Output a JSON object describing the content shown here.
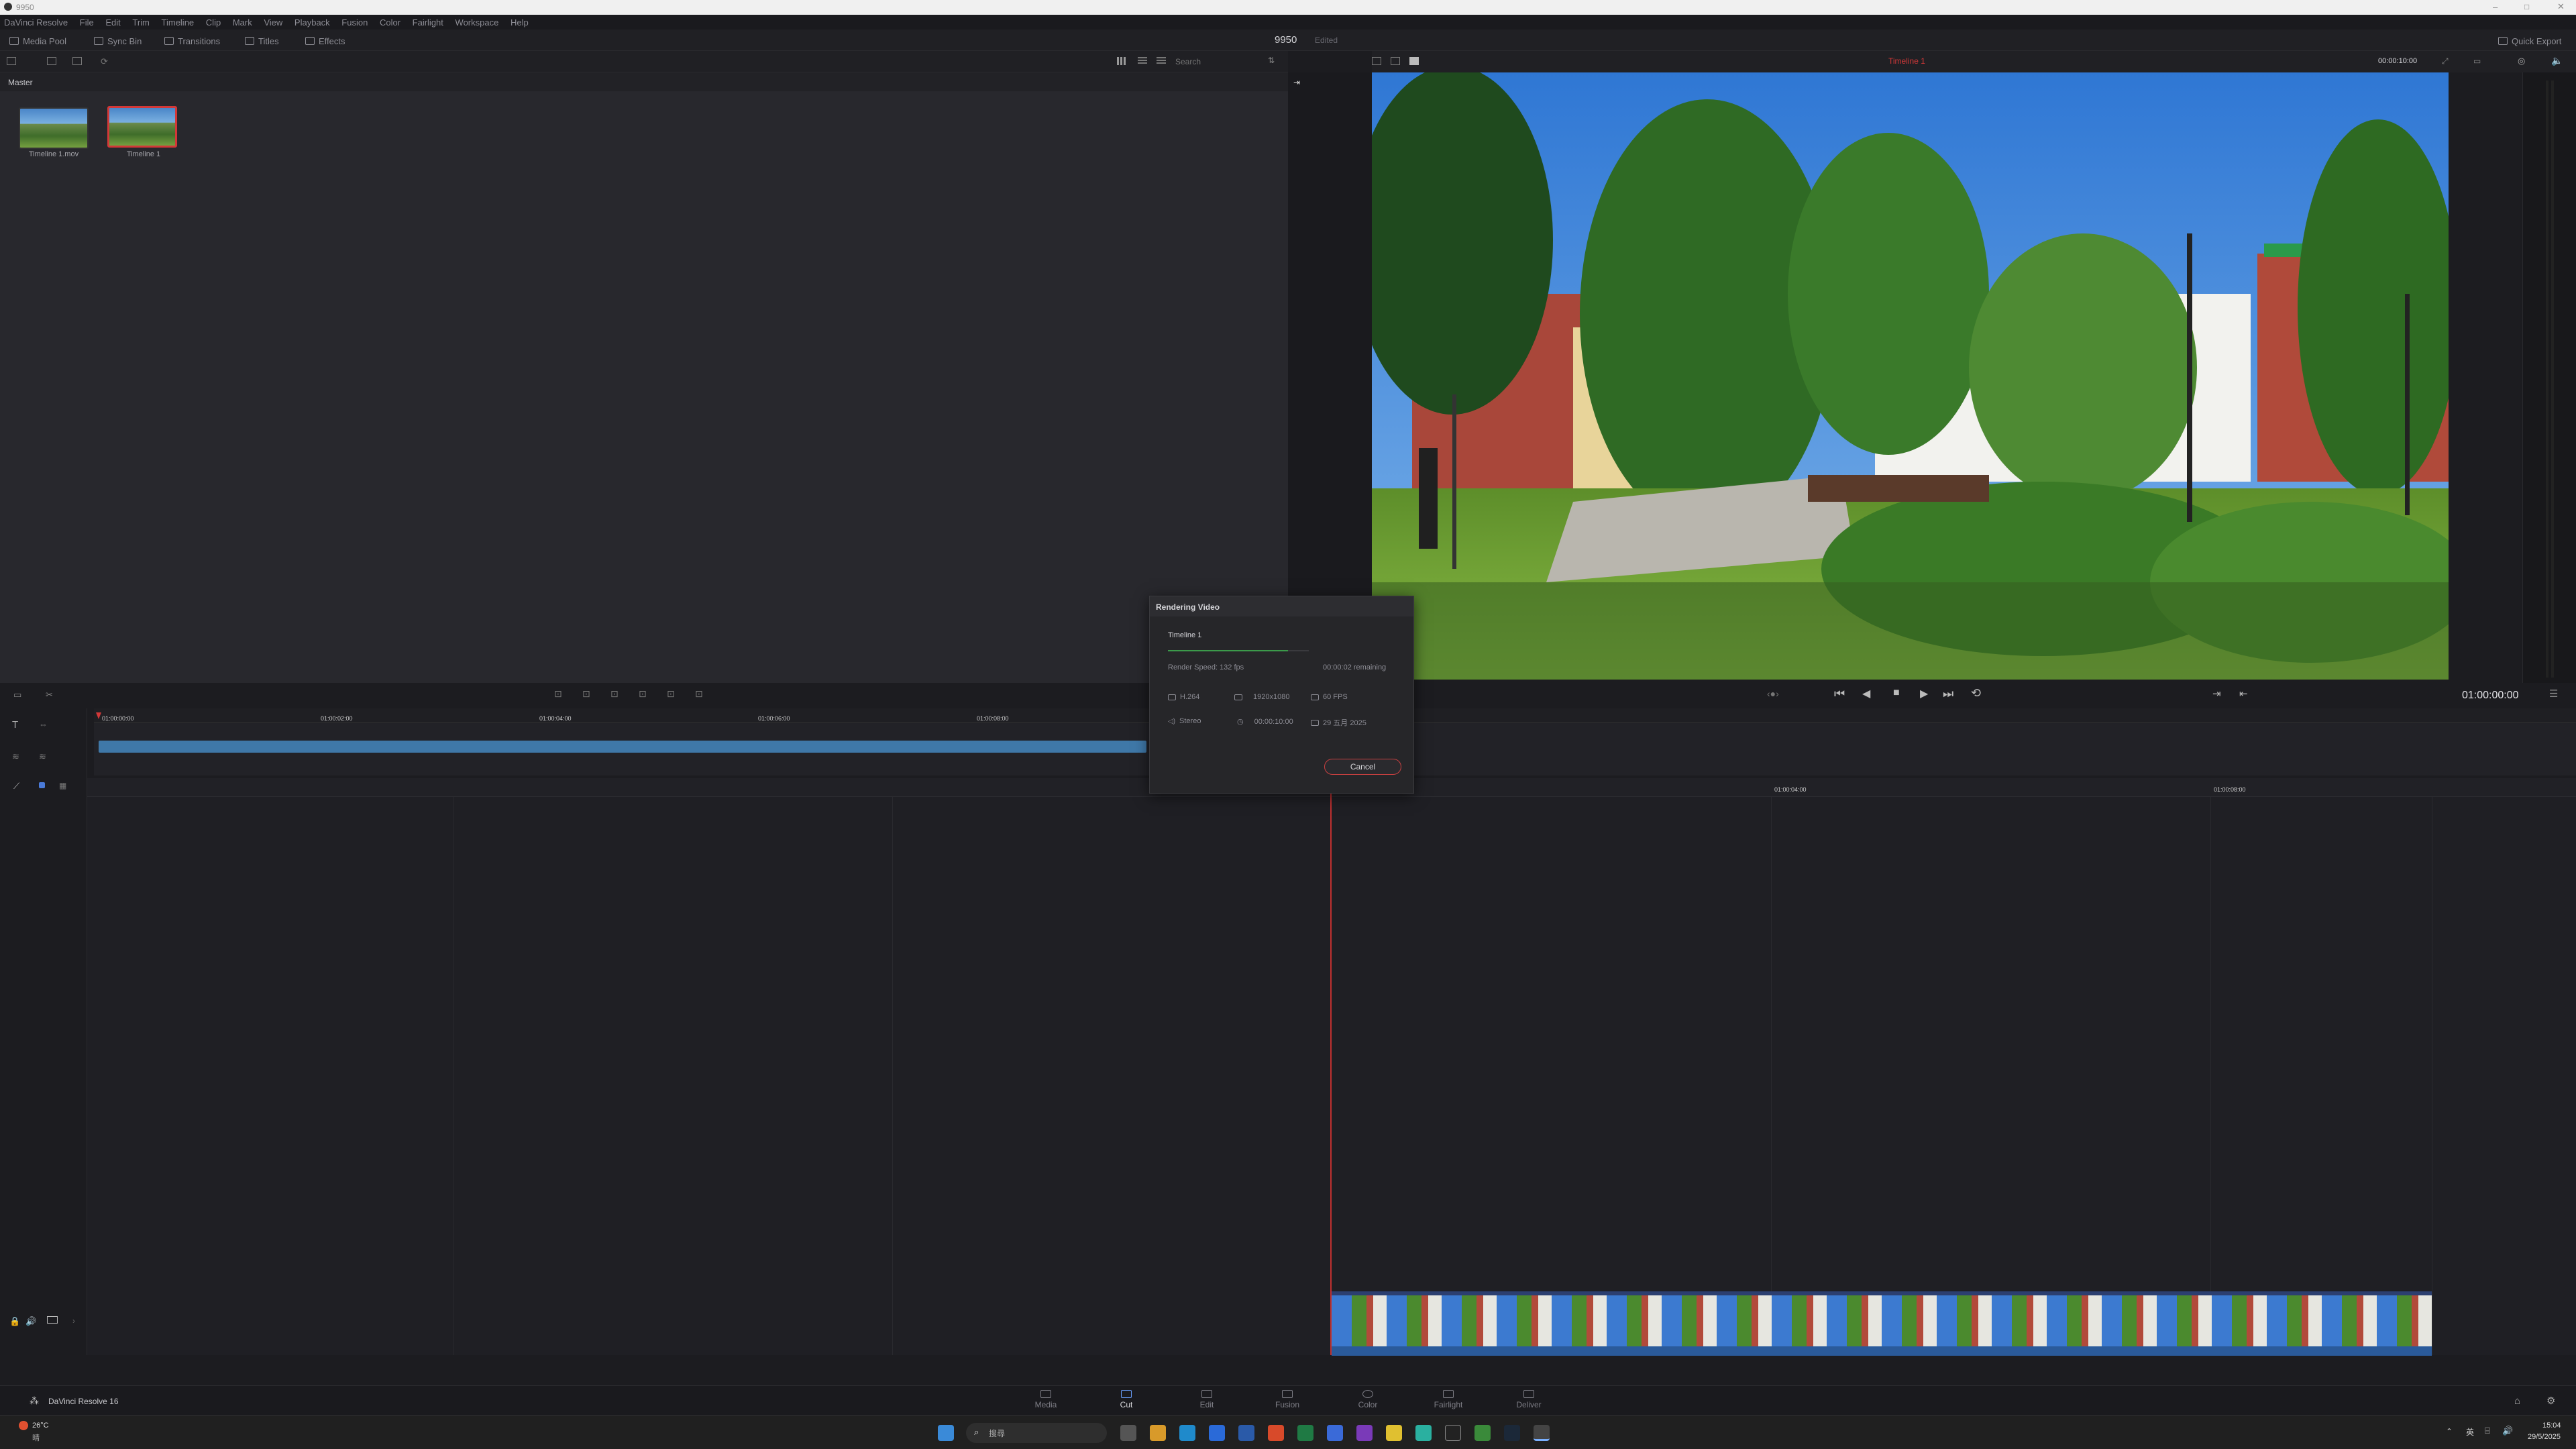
{
  "window": {
    "title": "9950"
  },
  "menu": [
    "DaVinci Resolve",
    "File",
    "Edit",
    "Trim",
    "Timeline",
    "Clip",
    "Mark",
    "View",
    "Playback",
    "Fusion",
    "Color",
    "Fairlight",
    "Workspace",
    "Help"
  ],
  "toolbar": {
    "media_pool": "Media Pool",
    "sync_bin": "Sync Bin",
    "transitions": "Transitions",
    "titles": "Titles",
    "effects": "Effects",
    "project_name": "9950",
    "project_status": "Edited",
    "quick_export": "Quick Export"
  },
  "media_pool": {
    "search_placeholder": "Search",
    "bin": "Master",
    "clips": [
      {
        "label": "Timeline 1.mov",
        "selected": false
      },
      {
        "label": "Timeline 1",
        "selected": true
      }
    ]
  },
  "viewer": {
    "timeline_name": "Timeline 1",
    "duration": "00:00:10:00",
    "timecode": "01:00:00:00"
  },
  "upper_ruler": [
    "01:00:00:00",
    "01:00:02:00",
    "01:00:04:00",
    "01:00:06:00",
    "01:00:08:00"
  ],
  "lower_ruler": [
    "01:00:04:00",
    "01:00:08:00"
  ],
  "dialog": {
    "title": "Rendering Video",
    "job": "Timeline 1",
    "progress": 0.85,
    "speed": "Render Speed: 132 fps",
    "remaining": "00:00:02 remaining",
    "codec": "H.264",
    "resolution": "1920x1080",
    "fps": "60 FPS",
    "audio": "Stereo",
    "duration": "00:00:10:00",
    "date": "29 五月 2025",
    "cancel": "Cancel"
  },
  "pages": [
    {
      "label": "Media",
      "active": false
    },
    {
      "label": "Cut",
      "active": true
    },
    {
      "label": "Edit",
      "active": false
    },
    {
      "label": "Fusion",
      "active": false
    },
    {
      "label": "Color",
      "active": false
    },
    {
      "label": "Fairlight",
      "active": false
    },
    {
      "label": "Deliver",
      "active": false
    }
  ],
  "app_brand": "DaVinci Resolve 16",
  "taskbar": {
    "weather_temp": "26°C",
    "weather_desc": "晴",
    "search_placeholder": "搜尋",
    "time": "15:04",
    "date": "29/5/2025",
    "ime": "英"
  },
  "colors": {
    "accent_red": "#d23838",
    "clip_blue": "#3f78a8",
    "progress_green": "#3b9a4a"
  }
}
